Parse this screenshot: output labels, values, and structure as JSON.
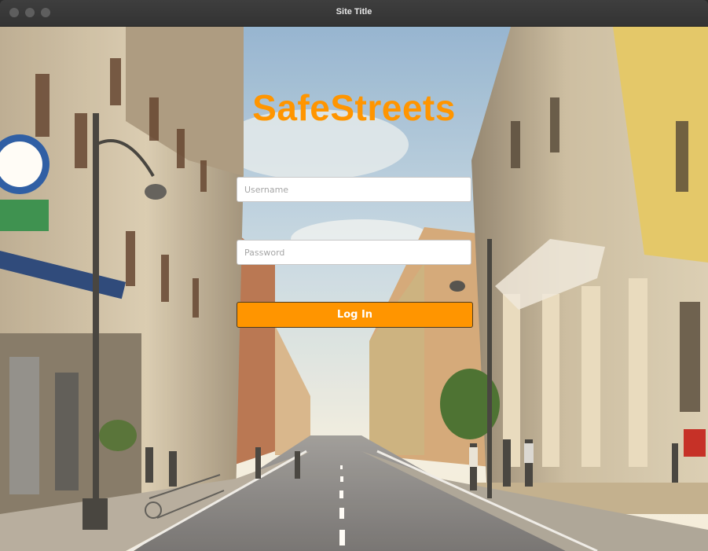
{
  "window": {
    "title": "Site Title"
  },
  "app": {
    "title": "SafeStreets"
  },
  "login_form": {
    "username_placeholder": "Username",
    "username_value": "",
    "password_placeholder": "Password",
    "password_value": "",
    "login_button_label": "Log In"
  },
  "colors": {
    "accent": "#ff9500",
    "titlebar": "#3a3a3a",
    "input_background": "#ffffff"
  }
}
